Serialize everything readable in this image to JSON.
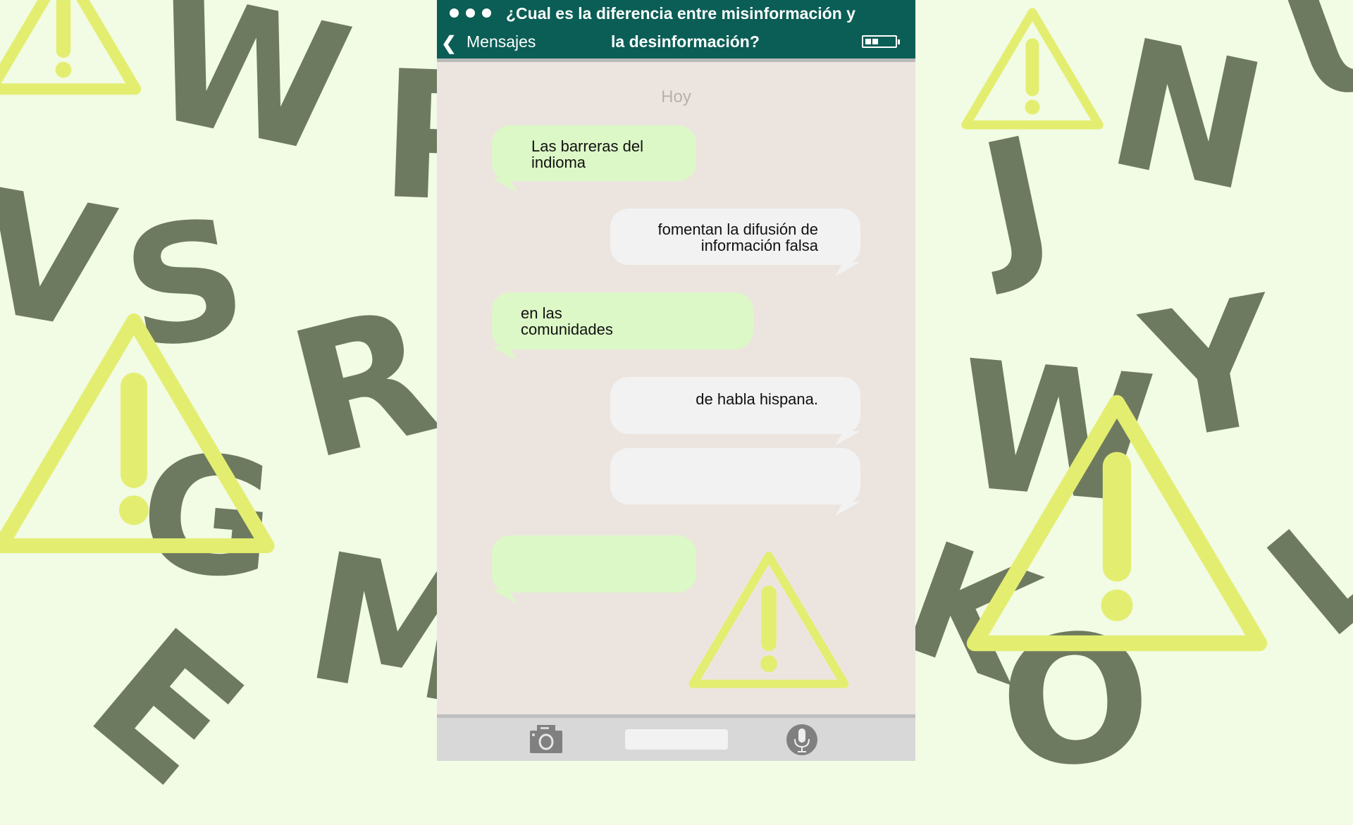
{
  "background_letters": [
    "W",
    "P",
    "S",
    "R",
    "G",
    "M",
    "E",
    "V",
    "J",
    "N",
    "W",
    "Y",
    "U",
    "O",
    "K",
    "L"
  ],
  "header": {
    "title_line1": "¿Cual es la diferencia entre misinformación y",
    "title_line2": "la desinformación?",
    "back_label": "Mensajes"
  },
  "chat": {
    "date_label": "Hoy",
    "messages": [
      {
        "side": "left",
        "text_lines": [
          "Las barreras del",
          "indioma"
        ]
      },
      {
        "side": "right",
        "text_lines": [
          "fomentan la difusión de",
          "información falsa"
        ]
      },
      {
        "side": "left",
        "text_lines": [
          "en las",
          "comunidades"
        ]
      },
      {
        "side": "right",
        "text_lines": [
          "de habla hispana."
        ]
      },
      {
        "side": "right",
        "text_lines": []
      },
      {
        "side": "left",
        "text_lines": []
      }
    ]
  },
  "colors": {
    "header": "#0a5e55",
    "bubble_in": "#dcf8c6",
    "bubble_out": "#f2f2f2",
    "chat_bg": "#ece5df",
    "warning": "#e3ee70",
    "letters": "#6e7a60",
    "page_bg": "#f2fbe4"
  }
}
